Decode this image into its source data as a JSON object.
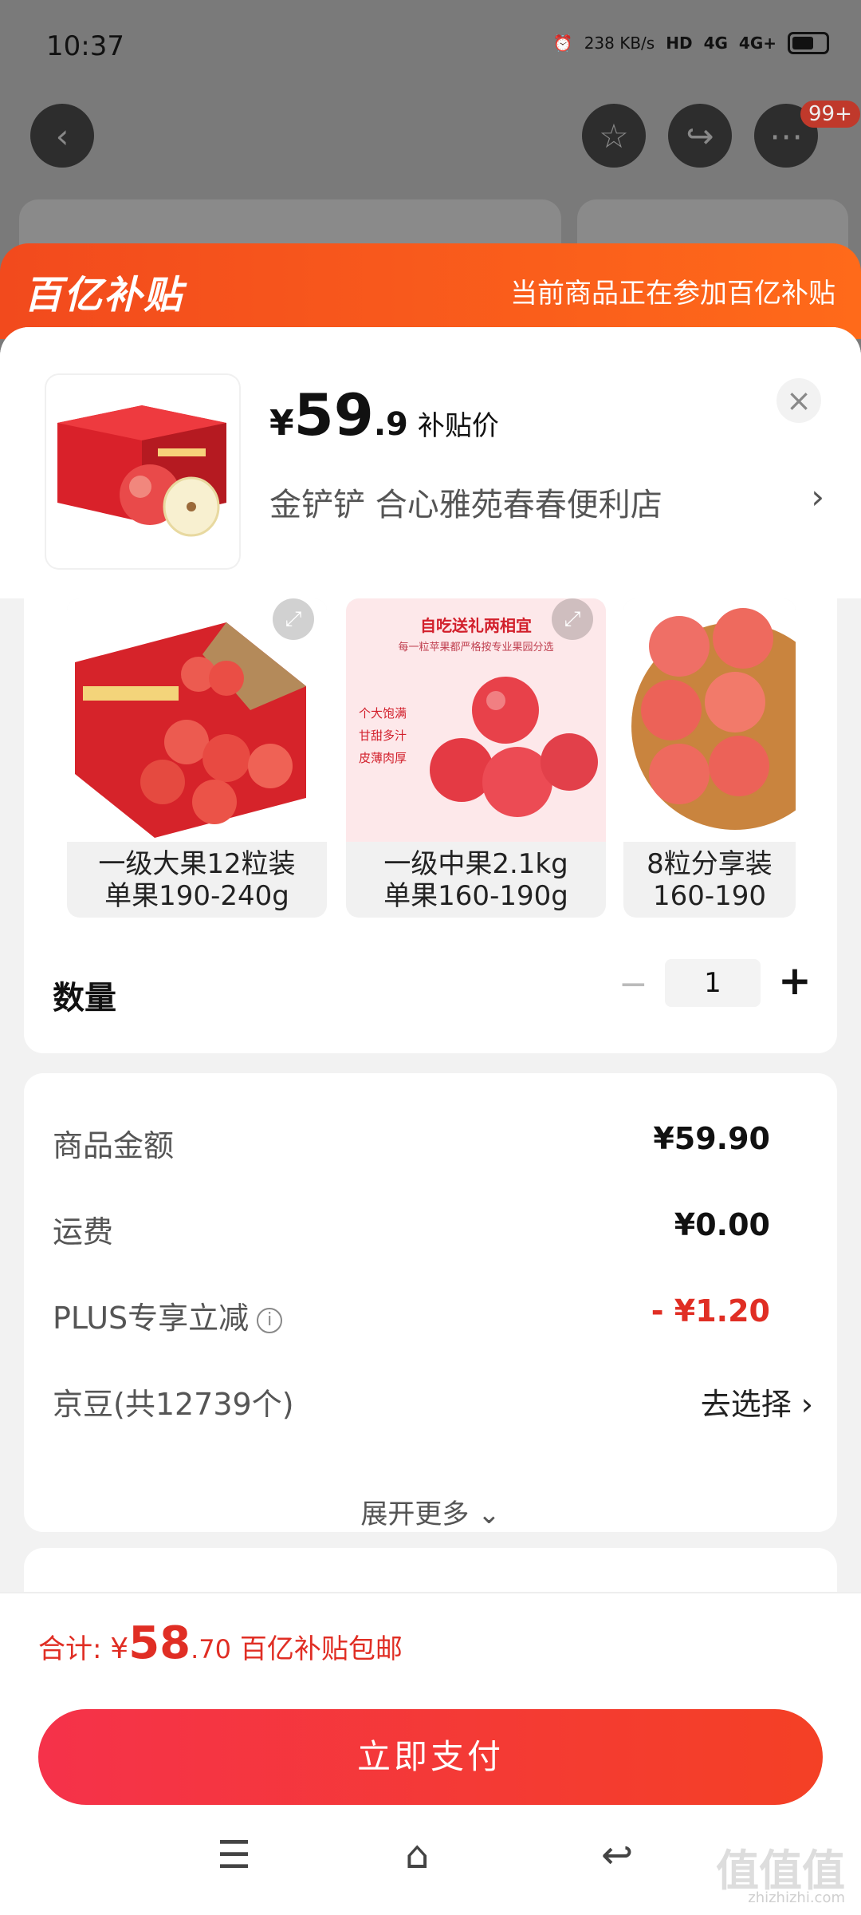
{
  "status": {
    "time": "10:37",
    "net_speed": "238 KB/s",
    "hd": "HD",
    "sig1": "4G",
    "sig2": "4G+"
  },
  "topbar": {
    "badge": "99+"
  },
  "subsidy": {
    "logo": "百亿补贴",
    "note": "当前商品正在参加百亿补贴"
  },
  "product": {
    "price_symbol": "¥",
    "price_int": "59",
    "price_dec": ".9",
    "price_tag": "补贴价",
    "shop": "金铲铲  合心雅苑春春便利店"
  },
  "variants": [
    {
      "line1": "一级大果12粒装",
      "line2": "单果190-240g"
    },
    {
      "line1": "一级中果2.1kg",
      "line2": "单果160-190g",
      "img_title": "自吃送礼两相宜",
      "img_sub": "每一粒苹果都严格按专业果园分选",
      "img_points": [
        "个大饱满",
        "甘甜多汁",
        "皮薄肉厚"
      ]
    },
    {
      "line1": "8粒分享装",
      "line2": "160-190"
    }
  ],
  "quantity": {
    "label": "数量",
    "value": "1",
    "minus": "−",
    "plus": "+"
  },
  "fees": {
    "goods_label": "商品金额",
    "goods_value": "¥59.90",
    "ship_label": "运费",
    "ship_value": "¥0.00",
    "plus_label": "PLUS专享立减",
    "plus_value": "- ¥1.20",
    "jd_label": "京豆(共12739个)",
    "jd_action": "去选择",
    "more": "展开更多"
  },
  "footer": {
    "total_label": "合计:",
    "total_symbol": "¥",
    "total_int": "58",
    "total_dec": ".70",
    "total_note": "百亿补贴包邮",
    "pay": "立即支付"
  },
  "watermark": {
    "main": "值值值",
    "sub": "zhizhizhi.com"
  },
  "colors": {
    "accent": "#e02e24",
    "subsidy": "#f24a1d",
    "pay": "#f5324a"
  }
}
